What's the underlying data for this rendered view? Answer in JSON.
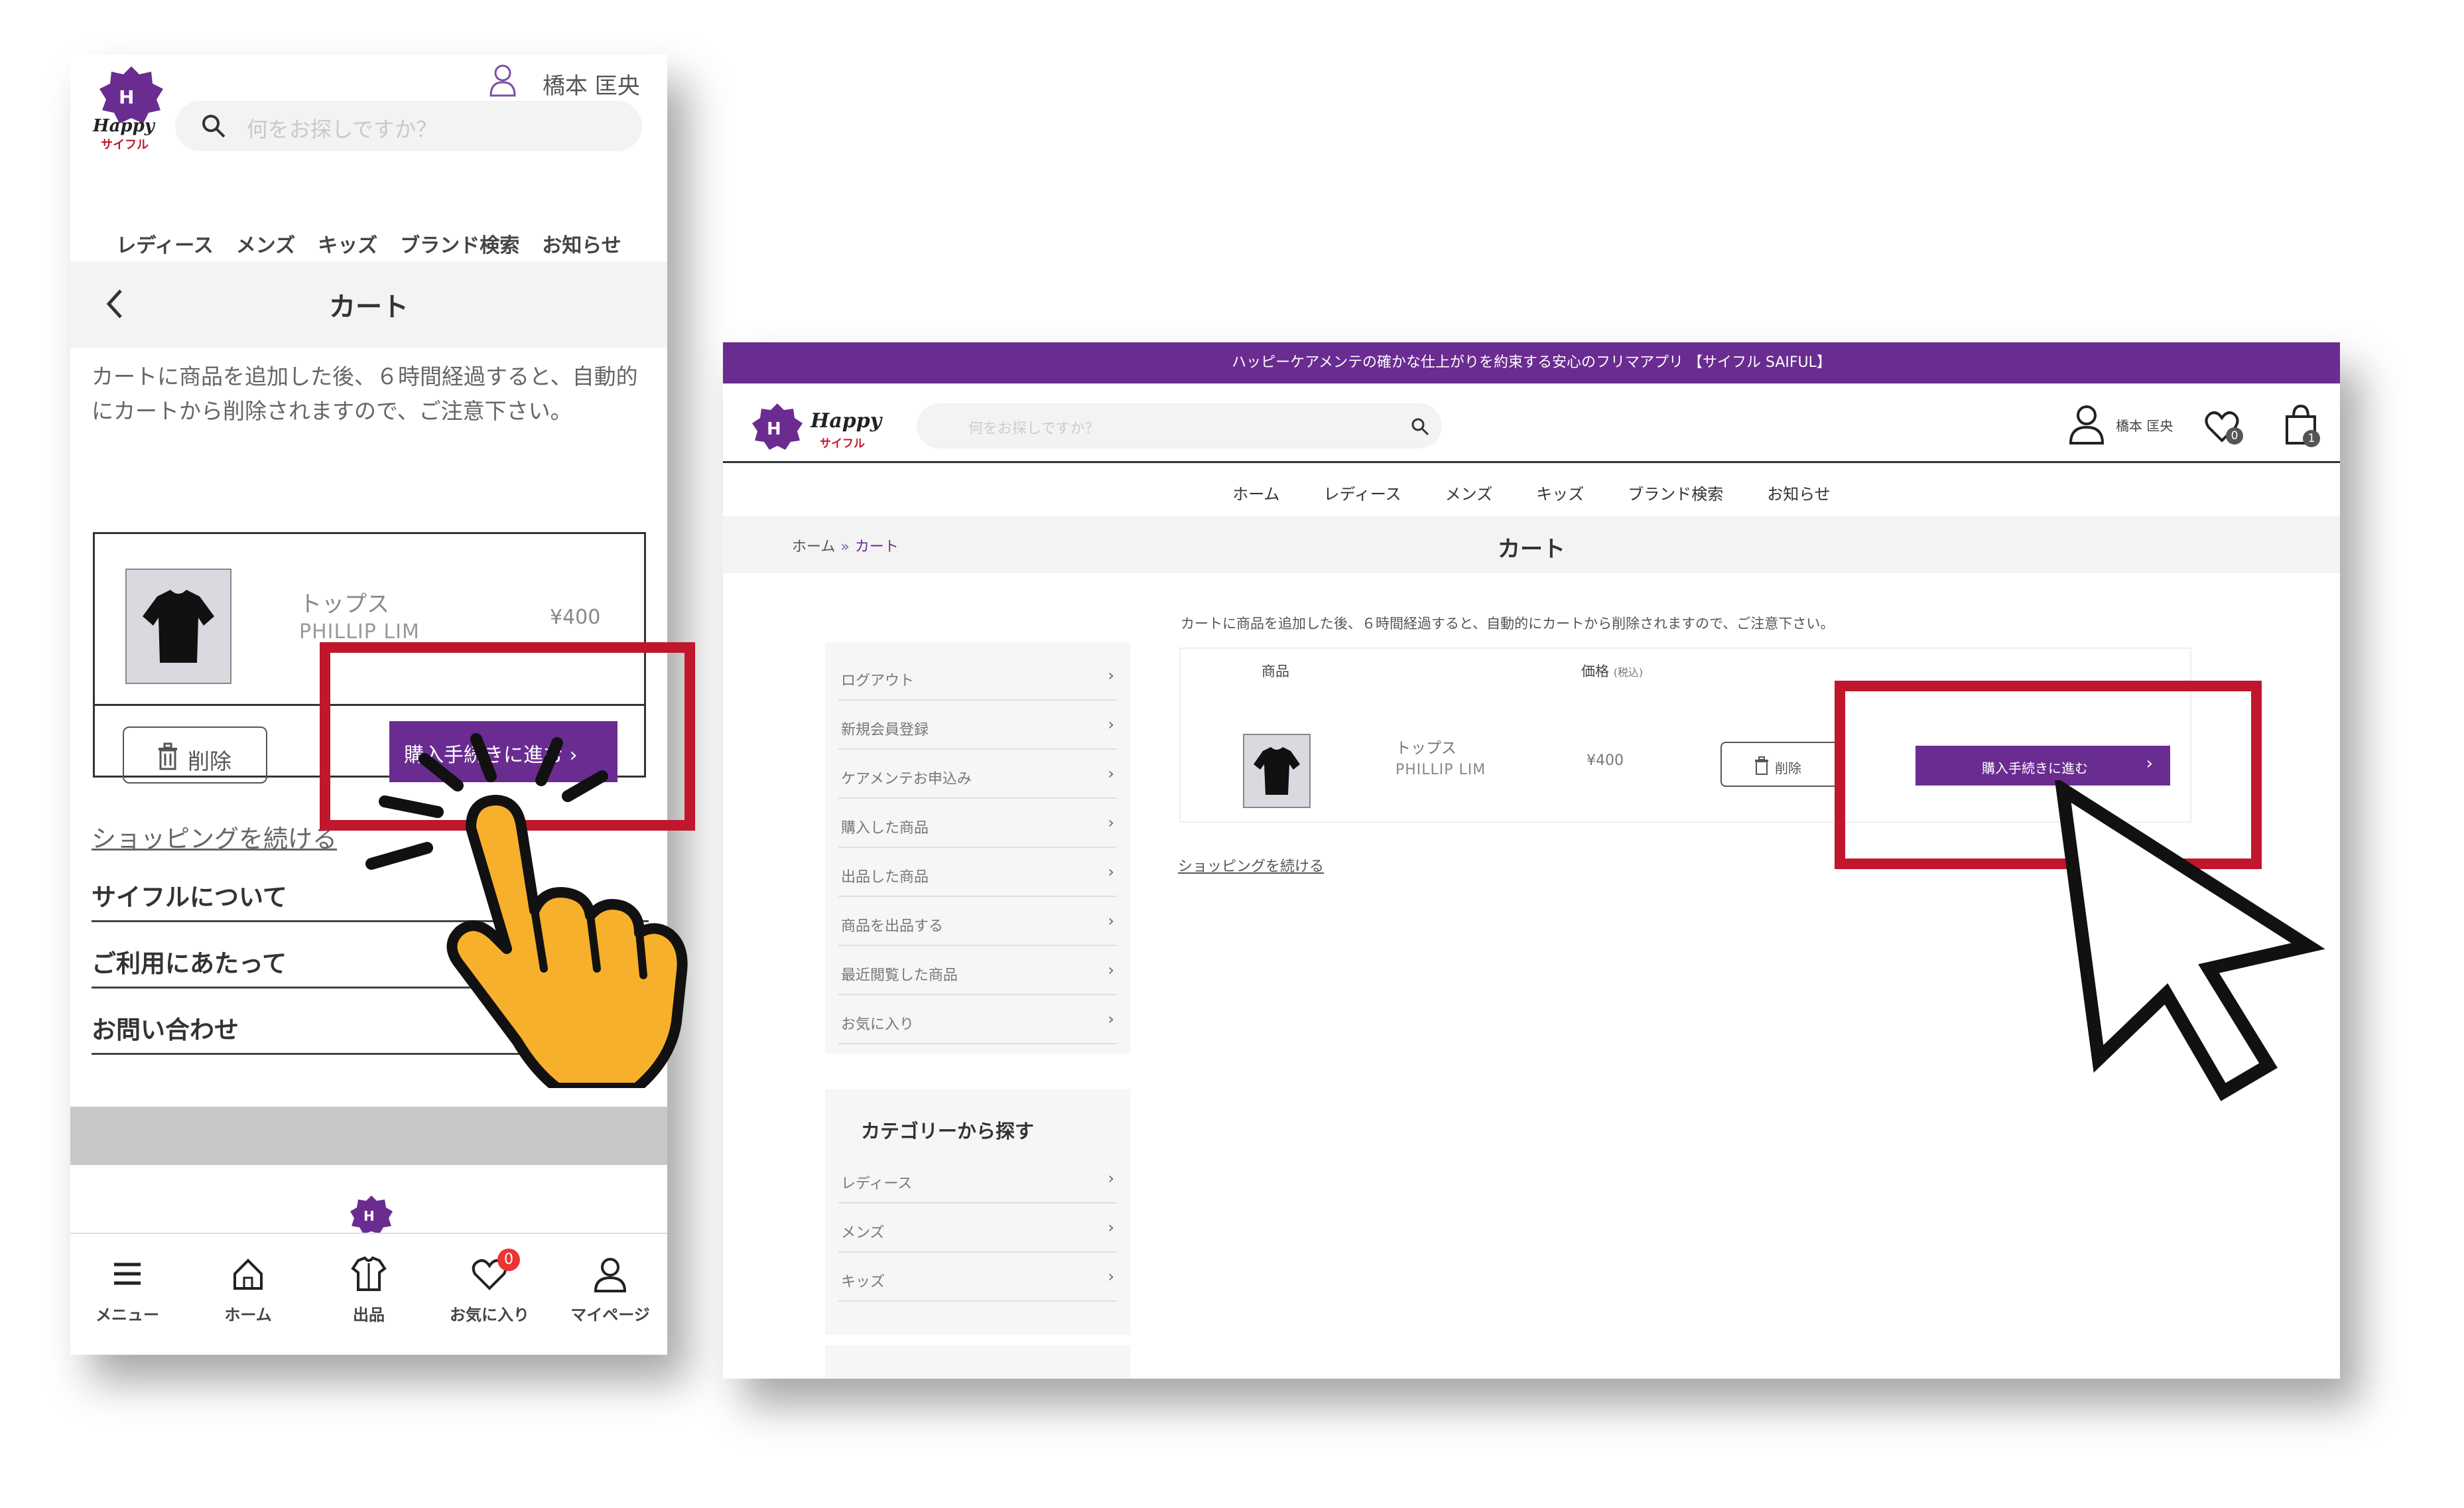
{
  "mobile": {
    "user_name": "橋本 匡央",
    "search_placeholder": "何をお探しですか？",
    "nav": [
      "レディース",
      "メンズ",
      "キッズ",
      "ブランド検索",
      "お知らせ"
    ],
    "cart_title": "カート",
    "notice": "カートに商品を追加した後、６時間経過すると、自動的にカートから削除されますので、ご注意下さい。",
    "item": {
      "name": "トップス",
      "brand": "PHILLIP LIM",
      "price": "¥400",
      "delete_label": "削除",
      "buy_label": "購入手続きに進む",
      "buy_chevron": "›"
    },
    "continue_shopping": "ショッピングを続ける",
    "links": [
      "サイフルについて",
      "ご利用にあたって",
      "お問い合わせ"
    ],
    "tabs": [
      {
        "label": "メニュー",
        "icon": "menu-icon"
      },
      {
        "label": "ホーム",
        "icon": "home-icon"
      },
      {
        "label": "出品",
        "icon": "sell-shirt-icon"
      },
      {
        "label": "お気に入り",
        "icon": "heart-icon",
        "badge": "0"
      },
      {
        "label": "マイページ",
        "icon": "user-icon"
      }
    ]
  },
  "desktop": {
    "banner": "ハッピーケアメンテの確かな仕上がりを約束する安心のフリマアプリ 【サイフル SAIFUL】",
    "search_placeholder": "何をお探しですか？",
    "user_name": "橋本 匡央",
    "favorites_count": "0",
    "cart_count": "1",
    "nav": [
      "ホーム",
      "レディース",
      "メンズ",
      "キッズ",
      "ブランド検索",
      "お知らせ"
    ],
    "breadcrumb": {
      "home": "ホーム",
      "sep": "»",
      "current": "カート"
    },
    "cart_title": "カート",
    "sidebar": [
      "ログアウト",
      "新規会員登録",
      "ケアメンテお申込み",
      "購入した商品",
      "出品した商品",
      "商品を出品する",
      "最近閲覧した商品",
      "お気に入り"
    ],
    "category_title": "カテゴリーから探す",
    "categories": [
      "レディース",
      "メンズ",
      "キッズ"
    ],
    "chevron": "›",
    "notice": "カートに商品を追加した後、６時間経過すると、自動的にカートから削除されますので、ご注意下さい。",
    "table": {
      "col_item": "商品",
      "col_price": "価格",
      "col_price_note": "(税込)"
    },
    "item": {
      "name": "トップス",
      "brand": "PHILLIP LIM",
      "price": "¥400",
      "delete_label": "削除",
      "buy_label": "購入手続きに進む",
      "buy_chevron": "›"
    },
    "continue_shopping": "ショッピングを続ける"
  },
  "colors": {
    "brand_purple": "#6a2c91",
    "highlight_red": "#c0172d",
    "hand_yellow": "#f6b02b"
  }
}
